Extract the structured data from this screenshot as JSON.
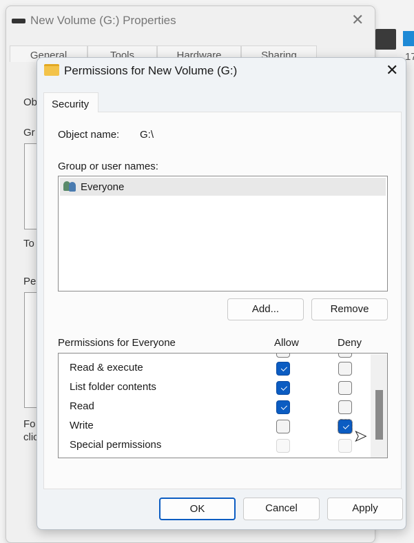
{
  "background_window": {
    "title": "New Volume (G:) Properties",
    "tabs": [
      "General",
      "Tools",
      "Hardware",
      "Sharing"
    ],
    "fragments": [
      "Ob",
      "Gr",
      "To",
      "Pe",
      "Fo",
      "clic"
    ],
    "side_text": "17"
  },
  "dialog": {
    "title": "Permissions for New Volume (G:)",
    "tab": "Security",
    "object_name_label": "Object name:",
    "object_name_value": "G:\\",
    "group_label": "Group or user names:",
    "users": [
      {
        "name": "Everyone",
        "selected": true
      }
    ],
    "add_button": "Add...",
    "remove_button": "Remove",
    "permissions_label": "Permissions for Everyone",
    "allow_header": "Allow",
    "deny_header": "Deny",
    "permissions": [
      {
        "name": "Read & execute",
        "allow": true,
        "deny": false,
        "disabled": false
      },
      {
        "name": "List folder contents",
        "allow": true,
        "deny": false,
        "disabled": false
      },
      {
        "name": "Read",
        "allow": true,
        "deny": false,
        "disabled": false
      },
      {
        "name": "Write",
        "allow": false,
        "deny": true,
        "disabled": false
      },
      {
        "name": "Special permissions",
        "allow": false,
        "deny": false,
        "disabled": true
      }
    ],
    "ok_button": "OK",
    "cancel_button": "Cancel",
    "apply_button": "Apply"
  },
  "colors": {
    "accent": "#0b5cc2"
  }
}
